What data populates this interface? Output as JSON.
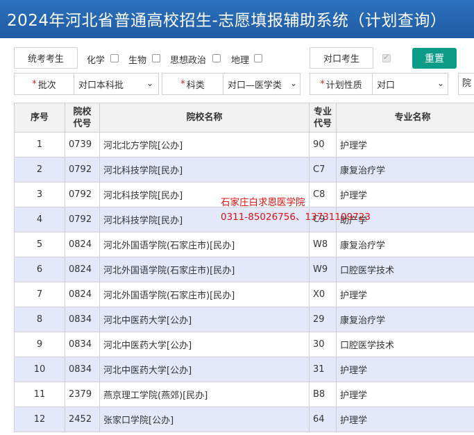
{
  "header": {
    "title": "2024年河北省普通高校招生-志愿填报辅助系统（计划查询）"
  },
  "filters": {
    "exam_type_button": "统考考生",
    "subjects": [
      {
        "label": "化学",
        "checked": false
      },
      {
        "label": "生物",
        "checked": false
      },
      {
        "label": "思想政治",
        "checked": false
      },
      {
        "label": "地理",
        "checked": false
      }
    ],
    "vocational_button": "对口考生",
    "vocational_checked": true,
    "reset_button": "重置",
    "batch": {
      "star": "*",
      "label": "批次",
      "value": "对口本科批"
    },
    "category": {
      "star": "*",
      "label": "科类",
      "value": "对口—医学类"
    },
    "plan_type": {
      "star": "*",
      "label": "计划性质",
      "value": "对口"
    },
    "truncated_label": "院"
  },
  "table": {
    "headers": {
      "index": "序号",
      "school_code_1": "院校",
      "school_code_2": "代号",
      "school_name": "院校名称",
      "major_code_1": "专业",
      "major_code_2": "代号",
      "major_name": "专业名称"
    },
    "rows": [
      {
        "index": "1",
        "school_code": "0739",
        "school_name": "河北北方学院[公办]",
        "major_code": "90",
        "major_name": "护理学"
      },
      {
        "index": "2",
        "school_code": "0792",
        "school_name": "河北科技学院[民办]",
        "major_code": "C7",
        "major_name": "康复治疗学"
      },
      {
        "index": "3",
        "school_code": "0792",
        "school_name": "河北科技学院[民办]",
        "major_code": "C8",
        "major_name": "护理学"
      },
      {
        "index": "4",
        "school_code": "0792",
        "school_name": "河北科技学院[民办]",
        "major_code": "C9",
        "major_name": "助产学"
      },
      {
        "index": "5",
        "school_code": "0824",
        "school_name": "河北外国语学院(石家庄市)[民办]",
        "major_code": "W8",
        "major_name": "康复治疗学"
      },
      {
        "index": "6",
        "school_code": "0824",
        "school_name": "河北外国语学院(石家庄市)[民办]",
        "major_code": "W9",
        "major_name": "口腔医学技术"
      },
      {
        "index": "7",
        "school_code": "0824",
        "school_name": "河北外国语学院(石家庄市)[民办]",
        "major_code": "X0",
        "major_name": "护理学"
      },
      {
        "index": "8",
        "school_code": "0834",
        "school_name": "河北中医药大学[公办]",
        "major_code": "29",
        "major_name": "康复治疗学"
      },
      {
        "index": "9",
        "school_code": "0834",
        "school_name": "河北中医药大学[公办]",
        "major_code": "30",
        "major_name": "口腔医学技术"
      },
      {
        "index": "10",
        "school_code": "0834",
        "school_name": "河北中医药大学[公办]",
        "major_code": "31",
        "major_name": "护理学"
      },
      {
        "index": "11",
        "school_code": "2379",
        "school_name": "燕京理工学院(燕郊)[民办]",
        "major_code": "B8",
        "major_name": "护理学"
      },
      {
        "index": "12",
        "school_code": "2452",
        "school_name": "张家口学院[公办]",
        "major_code": "64",
        "major_name": "护理学"
      }
    ]
  },
  "watermark": {
    "line1": "石家庄白求恩医学院",
    "line2": "0311-85026756、13731109723"
  }
}
